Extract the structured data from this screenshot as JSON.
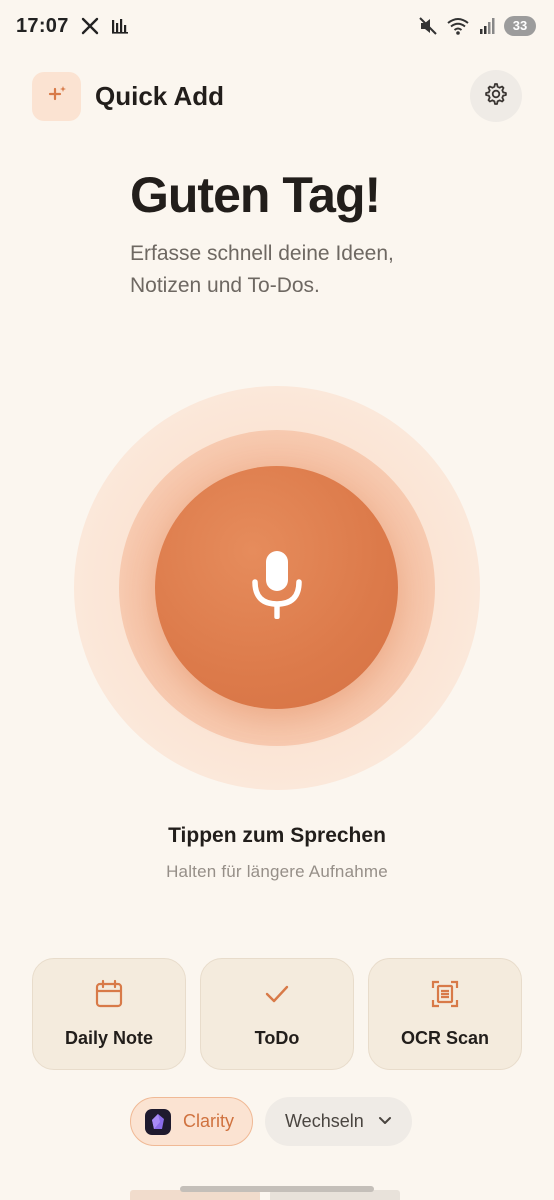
{
  "status_bar": {
    "time": "17:07",
    "icons": [
      "x-icon",
      "activity-icon",
      "mute-vibrate-icon",
      "wifi-icon",
      "signal-icon"
    ],
    "battery": "33"
  },
  "header": {
    "title": "Quick Add",
    "logo_icon": "sparkle-plus-icon",
    "settings_icon": "gear-icon"
  },
  "greeting": {
    "title": "Guten Tag!",
    "subtitle": "Erfasse schnell deine Ideen, Notizen und To-Dos."
  },
  "mic": {
    "icon": "microphone-icon",
    "primary_label": "Tippen zum Sprechen",
    "secondary_label": "Halten für längere Aufnahme"
  },
  "actions": [
    {
      "label": "Daily Note",
      "icon": "calendar-icon"
    },
    {
      "label": "ToDo",
      "icon": "checkmark-icon"
    },
    {
      "label": "OCR Scan",
      "icon": "document-scan-icon"
    }
  ],
  "vault": {
    "label": "Clarity",
    "icon": "obsidian-gem-icon",
    "switch_label": "Wechseln",
    "switch_icon": "chevron-down-icon"
  },
  "colors": {
    "background": "#FBF6EF",
    "accent": "#DC7A4A",
    "accent_light": "#FBE3D2",
    "card": "#F4EBDD"
  }
}
